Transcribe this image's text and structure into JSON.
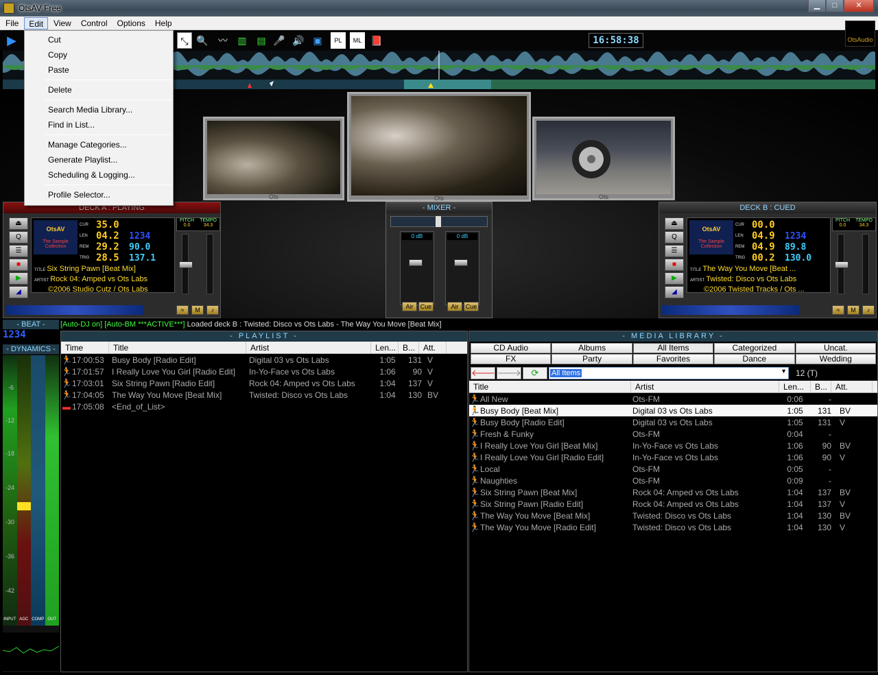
{
  "window": {
    "title": "OtsAV Free"
  },
  "menubar": [
    "File",
    "Edit",
    "View",
    "Control",
    "Options",
    "Help"
  ],
  "edit_menu": {
    "items": [
      "Cut",
      "Copy",
      "Paste",
      "Delete",
      "Search Media Library...",
      "Find in List...",
      "Manage Categories...",
      "Generate Playlist...",
      "Scheduling & Logging...",
      "Profile Selector..."
    ]
  },
  "toolbar": {
    "clock": "16:58:38",
    "logo": "OtsAudio"
  },
  "deck_a": {
    "header": "DECK A : PLAYING",
    "logo": "OtsAV",
    "logo_sub": "The Sample Collection",
    "cur": "35.0",
    "len": "04.2",
    "rem": "29.2",
    "trig": "28.5",
    "pitch": "0.0",
    "tempo": "34.3",
    "bpm": "90.0",
    "bpm2": "137.1",
    "code": "1234",
    "title": "Six String Pawn [Beat Mix]",
    "artist": "Rock 04: Amped vs Ots Labs",
    "copyright": "©2006 Studio Cutz / Ots Labs"
  },
  "deck_b": {
    "header": "DECK B : CUED",
    "logo": "OtsAV",
    "logo_sub": "The Sample Collection",
    "cur": "00.0",
    "len": "04.9",
    "rem": "04.9",
    "trig": "00.2",
    "pitch": "0.0",
    "tempo": "34.3",
    "bpm": "89.8",
    "bpm2": "130.0",
    "code": "1234",
    "title": "The Way You Move [Beat ...",
    "artist": "Twisted: Disco vs Ots Labs",
    "copyright": "©2006 Twisted Tracks / Ots ..."
  },
  "deck_labels": {
    "cur": "CUR",
    "len": "LEN",
    "rem": "REM",
    "trig": "TRIG",
    "title": "TITLE",
    "artist": "ARTIST",
    "pitch": "PITCH",
    "tempo": "TEMPO"
  },
  "mixer": {
    "header": "- MIXER -",
    "db_left": "0 dB",
    "db_right": "0 dB",
    "air": "Air",
    "cue": "Cue"
  },
  "status": {
    "autodj": "[Auto-DJ on]",
    "autobm": "[Auto-BM ***ACTIVE***]",
    "message": "Loaded deck B : Twisted: Disco vs Ots Labs - The Way You Move [Beat Mix]"
  },
  "beat": {
    "header": "- BEAT -",
    "value": "1234"
  },
  "dynamics": {
    "header": "- DYNAMICS -",
    "footer": [
      "INPUT",
      "AGC",
      "COMP",
      "OUT"
    ],
    "scale": [
      "-6",
      "-12",
      "-18",
      "-24",
      "-30",
      "-36",
      "-42"
    ]
  },
  "playlist": {
    "header": "- PLAYLIST -",
    "columns": [
      "Time",
      "Title",
      "Artist",
      "Len...",
      "B...",
      "Att."
    ],
    "rows": [
      {
        "time": "17:00:53",
        "title": "Busy Body [Radio Edit]",
        "artist": "Digital 03 vs Ots Labs",
        "len": "1:05",
        "bpm": "131",
        "att": "V"
      },
      {
        "time": "17:01:57",
        "title": "I Really Love You Girl [Radio Edit]",
        "artist": "In-Yo-Face vs Ots Labs",
        "len": "1:06",
        "bpm": "90",
        "att": "V"
      },
      {
        "time": "17:03:01",
        "title": "Six String Pawn [Radio Edit]",
        "artist": "Rock 04: Amped vs Ots Labs",
        "len": "1:04",
        "bpm": "137",
        "att": "V"
      },
      {
        "time": "17:04:05",
        "title": "The Way You Move [Beat Mix]",
        "artist": "Twisted: Disco vs Ots Labs",
        "len": "1:04",
        "bpm": "130",
        "att": "BV"
      },
      {
        "time": "17:05:08",
        "title": "<End_of_List>",
        "artist": "",
        "len": "",
        "bpm": "",
        "att": ""
      }
    ]
  },
  "library": {
    "header": "- MEDIA LIBRARY -",
    "categories": [
      "CD Audio",
      "Albums",
      "All Items",
      "Categorized",
      "Uncat.",
      "FX",
      "Party",
      "Favorites",
      "Dance",
      "Wedding"
    ],
    "filter": "All Items",
    "count": "12 (T)",
    "columns": [
      "Title",
      "Artist",
      "Len...",
      "B...",
      "Att."
    ],
    "rows": [
      {
        "title": "All New",
        "artist": "Ots-FM",
        "len": "0:06",
        "bpm": "-",
        "att": ""
      },
      {
        "title": "Busy Body [Beat Mix]",
        "artist": "Digital 03 vs Ots Labs",
        "len": "1:05",
        "bpm": "131",
        "att": "BV"
      },
      {
        "title": "Busy Body [Radio Edit]",
        "artist": "Digital 03 vs Ots Labs",
        "len": "1:05",
        "bpm": "131",
        "att": "V"
      },
      {
        "title": "Fresh & Funky",
        "artist": "Ots-FM",
        "len": "0:04",
        "bpm": "-",
        "att": ""
      },
      {
        "title": "I Really Love You Girl [Beat Mix]",
        "artist": "In-Yo-Face vs Ots Labs",
        "len": "1:06",
        "bpm": "90",
        "att": "BV"
      },
      {
        "title": "I Really Love You Girl [Radio Edit]",
        "artist": "In-Yo-Face vs Ots Labs",
        "len": "1:06",
        "bpm": "90",
        "att": "V"
      },
      {
        "title": "Local",
        "artist": "Ots-FM",
        "len": "0:05",
        "bpm": "-",
        "att": ""
      },
      {
        "title": "Naughties",
        "artist": "Ots-FM",
        "len": "0:09",
        "bpm": "-",
        "att": ""
      },
      {
        "title": "Six String Pawn [Beat Mix]",
        "artist": "Rock 04: Amped vs Ots Labs",
        "len": "1:04",
        "bpm": "137",
        "att": "BV"
      },
      {
        "title": "Six String Pawn [Radio Edit]",
        "artist": "Rock 04: Amped vs Ots Labs",
        "len": "1:04",
        "bpm": "137",
        "att": "V"
      },
      {
        "title": "The Way You Move [Beat Mix]",
        "artist": "Twisted: Disco vs Ots Labs",
        "len": "1:04",
        "bpm": "130",
        "att": "BV"
      },
      {
        "title": "The Way You Move [Radio Edit]",
        "artist": "Twisted: Disco vs Ots Labs",
        "len": "1:04",
        "bpm": "130",
        "att": "V"
      }
    ]
  }
}
